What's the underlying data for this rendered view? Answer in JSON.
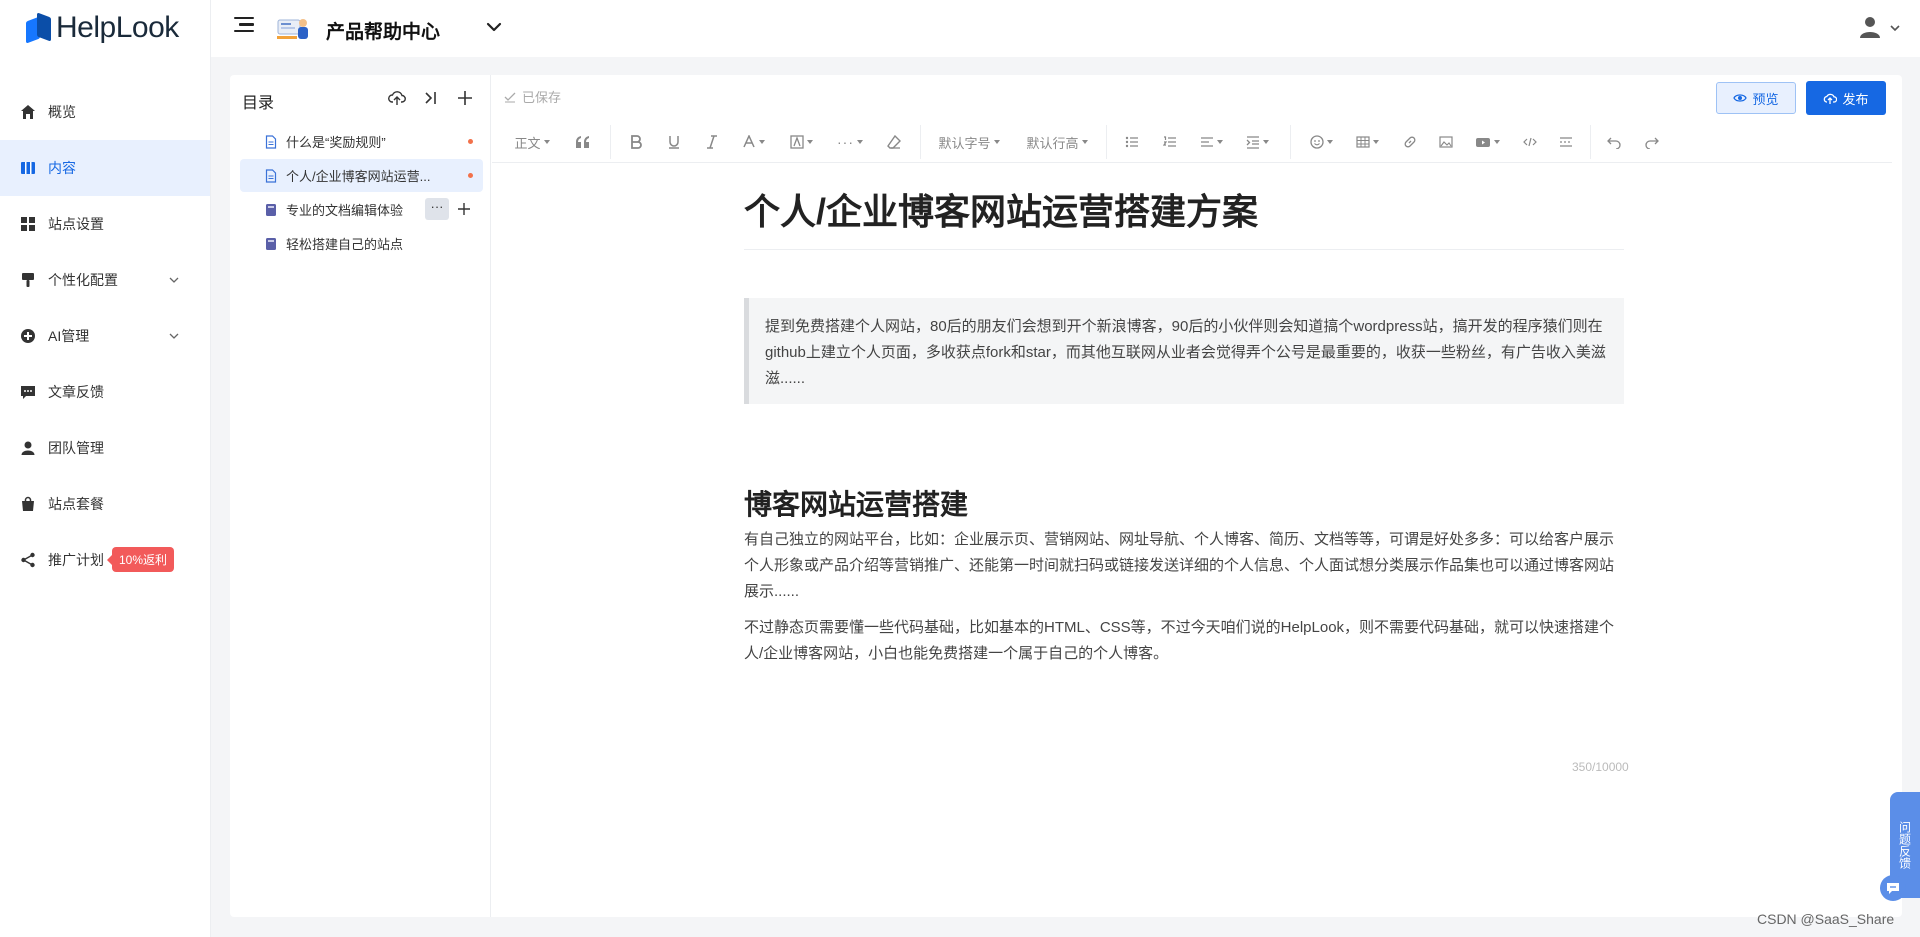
{
  "app": {
    "logo_text": "HelpLook"
  },
  "header": {
    "site_name": "产品帮助中心"
  },
  "sidebar": {
    "items": [
      {
        "label": "概览"
      },
      {
        "label": "内容"
      },
      {
        "label": "站点设置"
      },
      {
        "label": "个性化配置"
      },
      {
        "label": "AI管理"
      },
      {
        "label": "文章反馈"
      },
      {
        "label": "团队管理"
      },
      {
        "label": "站点套餐"
      },
      {
        "label": "推广计划",
        "badge": "10%返利"
      }
    ],
    "active_index": 1
  },
  "toc": {
    "title": "目录",
    "items": [
      {
        "label": "什么是“奖励规则”",
        "icon": "doc-icon",
        "unsaved": true
      },
      {
        "label": "个人/企业博客网站运营...",
        "icon": "doc-icon",
        "unsaved": true,
        "active": true
      },
      {
        "label": "专业的文档编辑体验",
        "icon": "book-icon",
        "more": "···"
      },
      {
        "label": "轻松搭建自己的站点",
        "icon": "book-icon"
      }
    ]
  },
  "editor": {
    "save_status": "已保存",
    "preview_label": "预览",
    "publish_label": "发布",
    "toolbar": {
      "paragraph_style": "正文",
      "font_size": "默认字号",
      "line_height": "默认行高"
    },
    "doc": {
      "title": "个人/企业博客网站运营搭建方案",
      "quote": "提到免费搭建个人网站，80后的朋友们会想到开个新浪博客，90后的小伙伴则会知道搞个wordpress站，搞开发的程序猿们则在github上建立个人页面，多收获点fork和star，而其他互联网从业者会觉得弄个公号是最重要的，收获一些粉丝，有广告收入美滋滋......",
      "heading": "博客网站运营搭建",
      "para1": "有自己独立的网站平台，比如：企业展示页、营销网站、网址导航、个人博客、简历、文档等等，可谓是好处多多：可以给客户展示个人形象或产品介绍等营销推广、还能第一时间就扫码或链接发送详细的个人信息、个人面试想分类展示作品集也可以通过博客网站展示......",
      "para2": "不过静态页需要懂一些代码基础，比如基本的HTML、CSS等，不过今天咱们说的HelpLook，则不需要代码基础，就可以快速搭建个人/企业博客网站，小白也能免费搭建一个属于自己的个人博客。"
    },
    "word_count": "350/10000"
  },
  "floating": {
    "feedback_label": "问题反馈"
  },
  "watermark": "CSDN @SaaS_Share",
  "colors": {
    "accent": "#1668e3",
    "active_bg": "#e8f0fe",
    "badge": "#f25a5a",
    "unsaved_dot": "#f2714a"
  }
}
